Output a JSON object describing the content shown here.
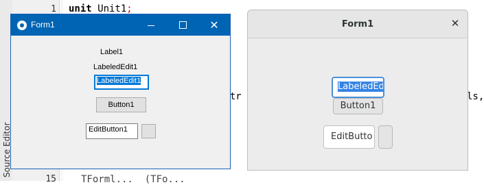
{
  "ide": {
    "tab_label": "Source Editor",
    "line_numbers": [
      "1",
      "15"
    ],
    "code": {
      "line1_kw": "unit",
      "line1_name": " Unit1",
      "line1_semi": ";",
      "frag_mid_left": "ontr",
      "frag_mid_right": "ls,",
      "frag_bottom": "TForml...  (TFo..."
    }
  },
  "win_form": {
    "title": "Form1",
    "label1": "Label1",
    "labeled_edit_caption": "LabeledEdit1",
    "labeled_edit_value": "LabeledEdit1",
    "button1": "Button1",
    "edit_button_value": "EditButton1",
    "close_glyph": "✕"
  },
  "gtk_form": {
    "title": "Form1",
    "close_glyph": "✕",
    "labeled_edit_value": "LabeledEd",
    "button1": "Button1",
    "edit_button_value": "EditButto"
  }
}
